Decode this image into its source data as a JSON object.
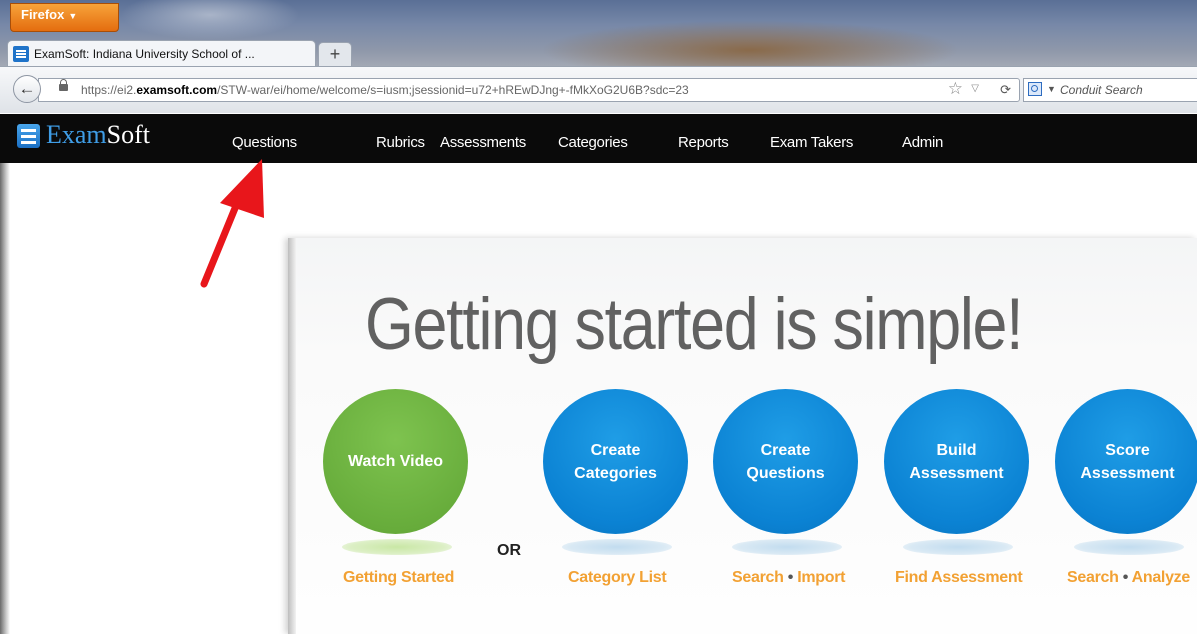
{
  "browser": {
    "menu_label": "Firefox",
    "tab_title": "ExamSoft: Indiana University School of ...",
    "new_tab_label": "+",
    "url_prefix": "https://ei2.",
    "url_domain": "examsoft.com",
    "url_path": "/STW-war/ei/home/welcome/s=iusm;jsessionid=u72+hREwDJng+-fMkXoG2U6B?sdc=23",
    "search_placeholder": "Conduit Search"
  },
  "app": {
    "logo_exam": "Exam",
    "logo_soft": "Soft",
    "nav": [
      "Questions",
      "Rubrics",
      "Assessments",
      "Categories",
      "Reports",
      "Exam Takers",
      "Admin"
    ]
  },
  "main": {
    "headline": "Getting started is simple!",
    "or_label": "OR",
    "steps": [
      {
        "circle": "Watch Video",
        "link": "Getting Started",
        "color": "#67ac3b"
      },
      {
        "circle": "Create Categories",
        "link": "Category List",
        "color": "#0b82d3"
      },
      {
        "circle": "Create Questions",
        "link_a": "Search",
        "link_b": "Import",
        "color": "#0b82d3"
      },
      {
        "circle": "Build Assessment",
        "link": "Find Assessment",
        "color": "#0b82d3"
      },
      {
        "circle": "Score Assessment",
        "link_a": "Search",
        "link_b": "Analyze",
        "color": "#0b82d3"
      }
    ],
    "link_separator": "•"
  },
  "annotation": {
    "arrow_color": "#e8161b"
  }
}
